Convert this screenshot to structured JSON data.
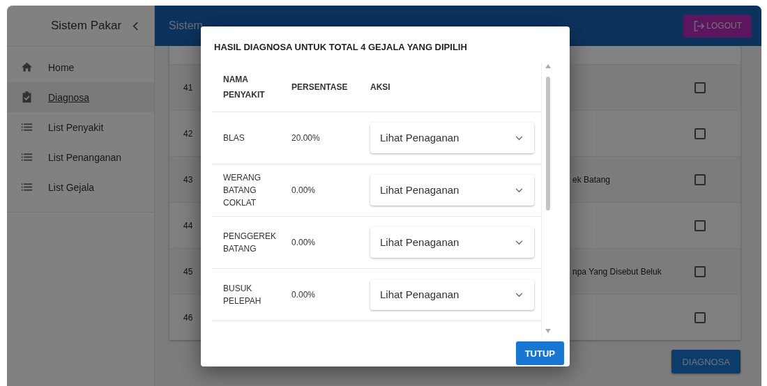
{
  "sidebar": {
    "title": "Sistem Pakar",
    "items": [
      {
        "label": "Home",
        "kind": "home",
        "selected": false
      },
      {
        "label": "Diagnosa",
        "kind": "clipboard",
        "selected": true
      },
      {
        "label": "List Penyakit",
        "kind": "list",
        "selected": false
      },
      {
        "label": "List Penanganan",
        "kind": "list",
        "selected": false
      },
      {
        "label": "List Gejala",
        "kind": "list",
        "selected": false
      }
    ]
  },
  "header": {
    "title": "Sistem",
    "logout": "LOGOUT"
  },
  "table": {
    "rows": [
      {
        "no": "41",
        "text": "",
        "checked": false
      },
      {
        "no": "42",
        "text": "",
        "checked": false
      },
      {
        "no": "43",
        "text": "ek Batang",
        "checked": false
      },
      {
        "no": "44",
        "text": "",
        "checked": false
      },
      {
        "no": "45",
        "text": "npa Yang Disebut Beluk",
        "checked": false
      },
      {
        "no": "46",
        "text": "",
        "checked": false
      }
    ]
  },
  "diagnose_button": "DIAGNOSA",
  "dialog": {
    "title": "HASIL DIAGNOSA UNTUK TOTAL 4 GEJALA YANG DIPILIH",
    "columns": [
      "NAMA PENYAKIT",
      "PERSENTASE",
      "AKSI"
    ],
    "rows": [
      {
        "name": "BLAS",
        "percent": "20.00%",
        "action": "Lihat Penaganan"
      },
      {
        "name": "WERANG BATANG COKLAT",
        "percent": "0.00%",
        "action": "Lihat Penaganan"
      },
      {
        "name": "PENGGEREK BATANG",
        "percent": "0.00%",
        "action": "Lihat Penaganan"
      },
      {
        "name": "BUSUK PELEPAH",
        "percent": "0.00%",
        "action": "Lihat Penaganan"
      }
    ],
    "close_button": "TUTUP"
  }
}
